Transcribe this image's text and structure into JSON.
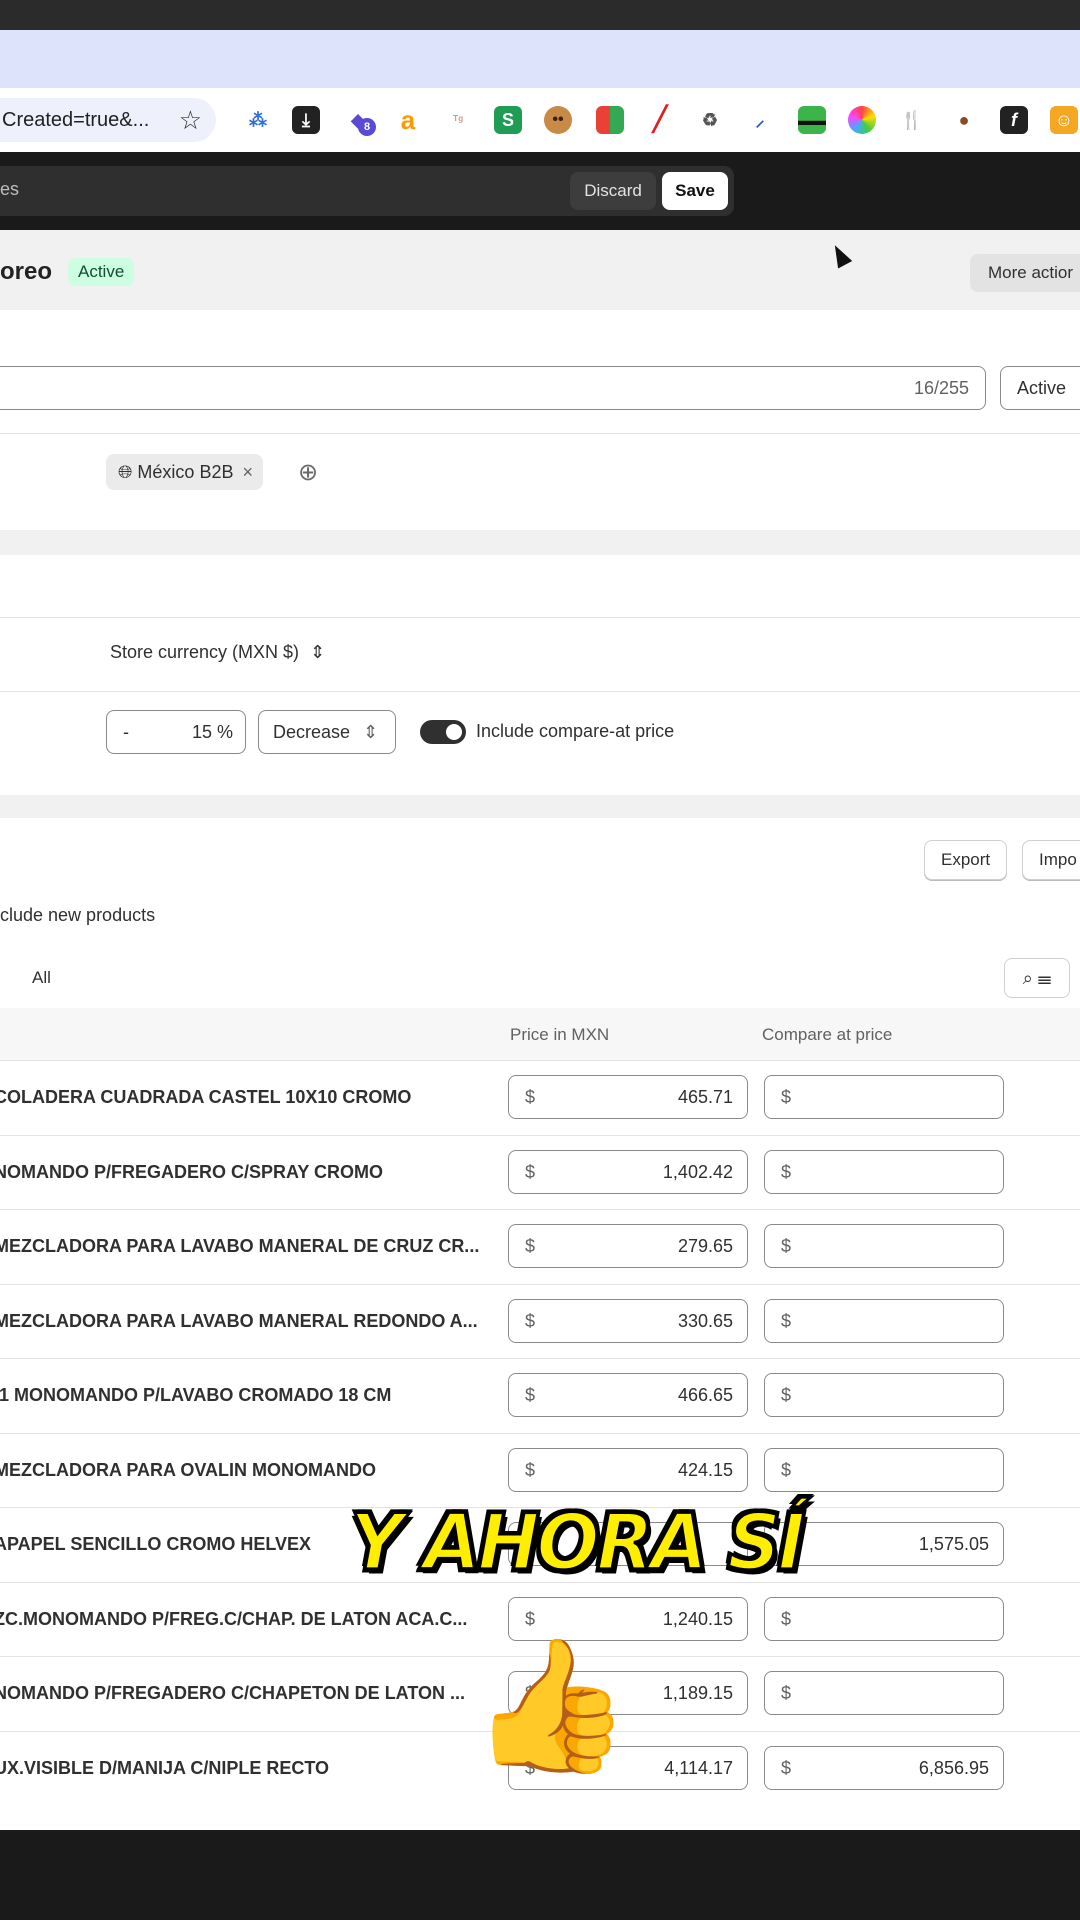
{
  "browser": {
    "url_fragment": "Created=true&...",
    "extensions": [
      "extension-1",
      "download-icon",
      "extension-badge",
      "amazon-icon",
      "extension-tag",
      "shopify-icon",
      "cookie-face-icon",
      "extension-squares",
      "pen-icon",
      "recycle-icon",
      "brush-icon",
      "glasses-icon",
      "circle-icon",
      "fork-knife-icon",
      "cookie-icon",
      "fx-icon",
      "extension-orange"
    ],
    "badge_count": "8"
  },
  "savebar": {
    "label": "ges",
    "discard": "Discard",
    "save": "Save"
  },
  "header": {
    "title": "oreo",
    "status": "Active",
    "more_actions": "More actior"
  },
  "name_field": {
    "counter": "16/255",
    "status_select": "Active"
  },
  "markets": {
    "tag": "México B2B"
  },
  "pricing": {
    "currency": "Store currency (MXN $)",
    "adjust_sign": "-",
    "adjust_value": "15 %",
    "direction": "Decrease",
    "include_compare": "Include compare-at price"
  },
  "products": {
    "export": "Export",
    "import": "Impo",
    "include_new": "clude new products",
    "filter_all": "All",
    "col_price": "Price in MXN",
    "col_compare": "Compare at price",
    "currency_symbol": "$",
    "rows": [
      {
        "name": "COLADERA CUADRADA CASTEL 10X10 CROMO",
        "price": "465.71",
        "compare": ""
      },
      {
        "name": "NOMANDO P/FREGADERO C/SPRAY CROMO",
        "price": "1,402.42",
        "compare": ""
      },
      {
        "name": "MEZCLADORA PARA LAVABO MANERAL DE CRUZ CR...",
        "price": "279.65",
        "compare": ""
      },
      {
        "name": "MEZCLADORA PARA LAVABO MANERAL REDONDO A...",
        "price": "330.65",
        "compare": ""
      },
      {
        "name": "/1 MONOMANDO P/LAVABO CROMADO 18 CM",
        "price": "466.65",
        "compare": ""
      },
      {
        "name": "MEZCLADORA PARA OVALIN MONOMANDO",
        "price": "424.15",
        "compare": ""
      },
      {
        "name": "APAPEL SENCILLO CROMO HELVEX",
        "price": "",
        "compare": "1,575.05"
      },
      {
        "name": "ZC.MONOMANDO P/FREG.C/CHAP. DE LATON ACA.C...",
        "price": "1,240.15",
        "compare": ""
      },
      {
        "name": "NOMANDO P/FREGADERO C/CHAPETON DE LATON ...",
        "price": "1,189.15",
        "compare": ""
      },
      {
        "name": "UX.VISIBLE D/MANIJA C/NIPLE RECTO",
        "price": "4,114.17",
        "compare": "6,856.95"
      }
    ]
  },
  "overlay": {
    "caption": "Y AHORA SÍ",
    "emoji": "👍"
  }
}
